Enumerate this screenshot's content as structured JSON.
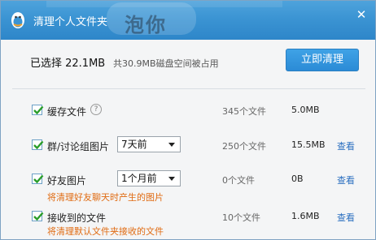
{
  "title": "清理个人文件夹",
  "title_watermark": "泡你",
  "summary": {
    "selected": "已选择 22.1MB",
    "detail": "共30.9MB磁盘空间被占用"
  },
  "clean_button": "立即清理",
  "rows": [
    {
      "label": "缓存文件",
      "count": "345个文件",
      "size": "5.0MB",
      "help": "?"
    },
    {
      "label": "群/讨论组图片",
      "select": "7天前",
      "count": "250个文件",
      "size": "15.5MB",
      "view": "查看"
    },
    {
      "label": "好友图片",
      "select": "1个月前",
      "count": "0个文件",
      "size": "0B",
      "view": "查看",
      "hint": "将清理好友聊天时产生的图片"
    },
    {
      "label": "接收到的文件",
      "count": "10个文件",
      "size": "1.6MB",
      "view": "查看",
      "hint": "将清理默认文件夹接收的文件"
    }
  ],
  "colors": {
    "titlebar": "#3b94d3",
    "accent_button": "#2b8bd6",
    "hint": "#e06b12",
    "link": "#2a6fc0"
  }
}
